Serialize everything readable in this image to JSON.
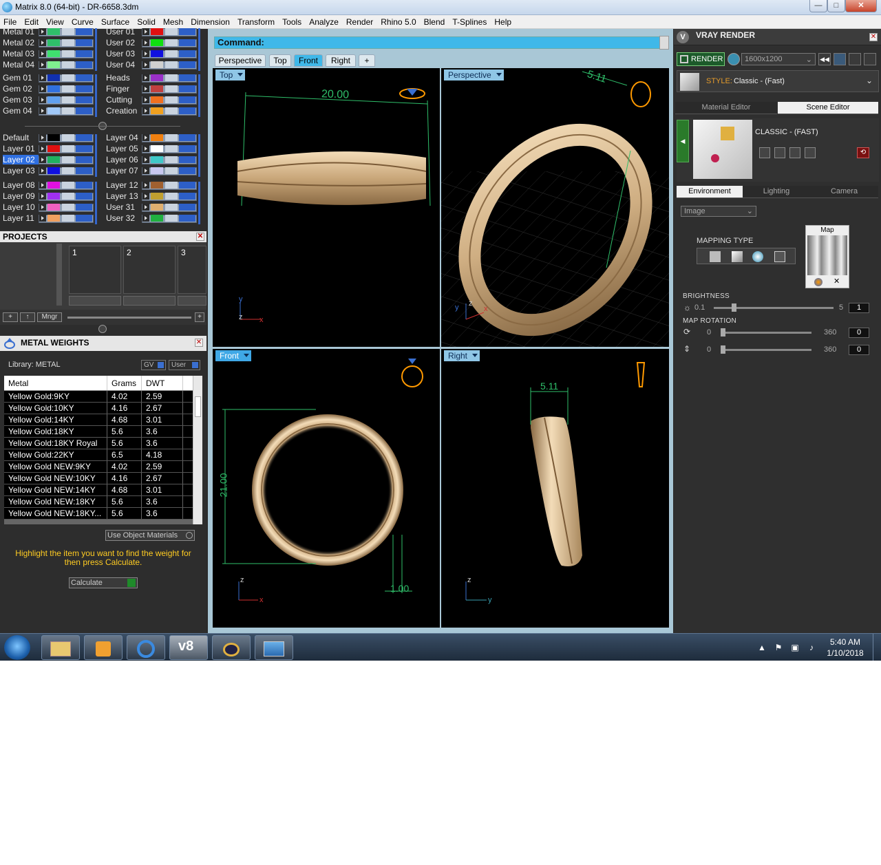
{
  "window": {
    "title": "Matrix 8.0 (64-bit) - DR-6658.3dm",
    "minimize": "—",
    "maximize": "□",
    "close": "✕"
  },
  "menu": [
    "File",
    "Edit",
    "View",
    "Curve",
    "Surface",
    "Solid",
    "Mesh",
    "Dimension",
    "Transform",
    "Tools",
    "Analyze",
    "Render",
    "Rhino 5.0",
    "Blend",
    "T-Splines",
    "Help"
  ],
  "layers": {
    "left_group1": [
      {
        "name": "Metal 01",
        "color": "#2fbf6a"
      },
      {
        "name": "Metal 02",
        "color": "#2fbf6a"
      },
      {
        "name": "Metal 03",
        "color": "#3fdf6f"
      },
      {
        "name": "Metal 04",
        "color": "#7fef8f"
      }
    ],
    "right_group1": [
      {
        "name": "User 01",
        "color": "#e01010"
      },
      {
        "name": "User 02",
        "color": "#10e010"
      },
      {
        "name": "User 03",
        "color": "#1010e0"
      },
      {
        "name": "User 04",
        "color": "#d0d0d0"
      }
    ],
    "left_group2": [
      {
        "name": "Gem 01",
        "color": "#1030b0"
      },
      {
        "name": "Gem 02",
        "color": "#3070e0"
      },
      {
        "name": "Gem 03",
        "color": "#60a0f0"
      },
      {
        "name": "Gem 04",
        "color": "#a0c8f8"
      }
    ],
    "right_group2": [
      {
        "name": "Heads",
        "color": "#9a30c8"
      },
      {
        "name": "Finger",
        "color": "#c04040"
      },
      {
        "name": "Cutting",
        "color": "#f07020"
      },
      {
        "name": "Creation",
        "color": "#f0a020"
      }
    ],
    "left_group3": [
      {
        "name": "Default",
        "color": "#000000"
      },
      {
        "name": "Layer 01",
        "color": "#e01010"
      },
      {
        "name": "Layer 02",
        "color": "#20b060",
        "selected": true
      },
      {
        "name": "Layer 03",
        "color": "#1010e0"
      }
    ],
    "right_group3": [
      {
        "name": "Layer 04",
        "color": "#f08010"
      },
      {
        "name": "Layer 05",
        "color": "#ffffff"
      },
      {
        "name": "Layer 06",
        "color": "#40c8c8"
      },
      {
        "name": "Layer 07",
        "color": "#c8c8f0"
      }
    ],
    "left_group4": [
      {
        "name": "Layer 08",
        "color": "#e010e0"
      },
      {
        "name": "Layer 09",
        "color": "#a030f0"
      },
      {
        "name": "Layer 10",
        "color": "#f060c0"
      },
      {
        "name": "Layer 11",
        "color": "#f0a060"
      }
    ],
    "right_group4": [
      {
        "name": "Layer 12",
        "color": "#a06030"
      },
      {
        "name": "Layer 13",
        "color": "#c0a030"
      },
      {
        "name": "User 31",
        "color": "#e0b070"
      },
      {
        "name": "User 32",
        "color": "#20b040"
      }
    ]
  },
  "projects": {
    "title": "PROJECTS",
    "slots": [
      "1",
      "2",
      "3"
    ],
    "mngr": "Mngr",
    "plus": "+"
  },
  "metal_weights": {
    "title": "METAL WEIGHTS",
    "library": "Library: METAL",
    "gv": "GV",
    "user": "User",
    "headers": [
      "Metal",
      "Grams",
      "DWT"
    ],
    "rows": [
      [
        "Yellow Gold:9KY",
        "4.02",
        "2.59"
      ],
      [
        "Yellow Gold:10KY",
        "4.16",
        "2.67"
      ],
      [
        "Yellow Gold:14KY",
        "4.68",
        "3.01"
      ],
      [
        "Yellow Gold:18KY",
        "5.6",
        "3.6"
      ],
      [
        "Yellow Gold:18KY Royal",
        "5.6",
        "3.6"
      ],
      [
        "Yellow Gold:22KY",
        "6.5",
        "4.18"
      ],
      [
        "Yellow Gold NEW:9KY",
        "4.02",
        "2.59"
      ],
      [
        "Yellow Gold NEW:10KY",
        "4.16",
        "2.67"
      ],
      [
        "Yellow Gold NEW:14KY",
        "4.68",
        "3.01"
      ],
      [
        "Yellow Gold NEW:18KY",
        "5.6",
        "3.6"
      ],
      [
        "Yellow Gold NEW:18KY...",
        "5.6",
        "3.6"
      ]
    ],
    "use_object_materials": "Use Object Materials",
    "hint": "Highlight the item you want to find the weight for then press Calculate.",
    "calculate": "Calculate"
  },
  "command": {
    "label": "Command:"
  },
  "view_tabs": [
    "Perspective",
    "Top",
    "Front",
    "Right",
    "+"
  ],
  "viewports": {
    "top": {
      "label": "Top",
      "dim": "20.00"
    },
    "perspective": {
      "label": "Perspective",
      "dim": "5.11"
    },
    "front": {
      "label": "Front",
      "dim_h": "21.00",
      "dim_w": "1.00"
    },
    "right": {
      "label": "Right",
      "dim": "5.11"
    }
  },
  "axes": {
    "x": "x",
    "y": "y",
    "z": "z"
  },
  "vray": {
    "title": "VRAY RENDER",
    "render": "RENDER",
    "resolution": "1600x1200",
    "style_label": "STYLE:",
    "style_value": "Classic - (Fast)",
    "tabs": [
      "Material Editor",
      "Scene Editor"
    ],
    "classic_title": "CLASSIC - (FAST)",
    "env_tabs": [
      "Environment",
      "Lighting",
      "Camera"
    ],
    "image_select": "Image",
    "map_label": "Map",
    "mapping_type": "MAPPING TYPE",
    "brightness": {
      "label": "BRIGHTNESS",
      "min": "0.1",
      "max": "5",
      "value": "1"
    },
    "map_rotation": {
      "label": "MAP ROTATION",
      "min": "0",
      "max": "360",
      "value1": "0",
      "value2": "0"
    }
  },
  "taskbar": {
    "time": "5:40 AM",
    "date": "1/10/2018",
    "active_label": "v8"
  },
  "colors": {
    "accent": "#3fb8e9",
    "gold": "#e2c49a",
    "dim": "#2fbf6a",
    "orange": "#ff9900"
  }
}
